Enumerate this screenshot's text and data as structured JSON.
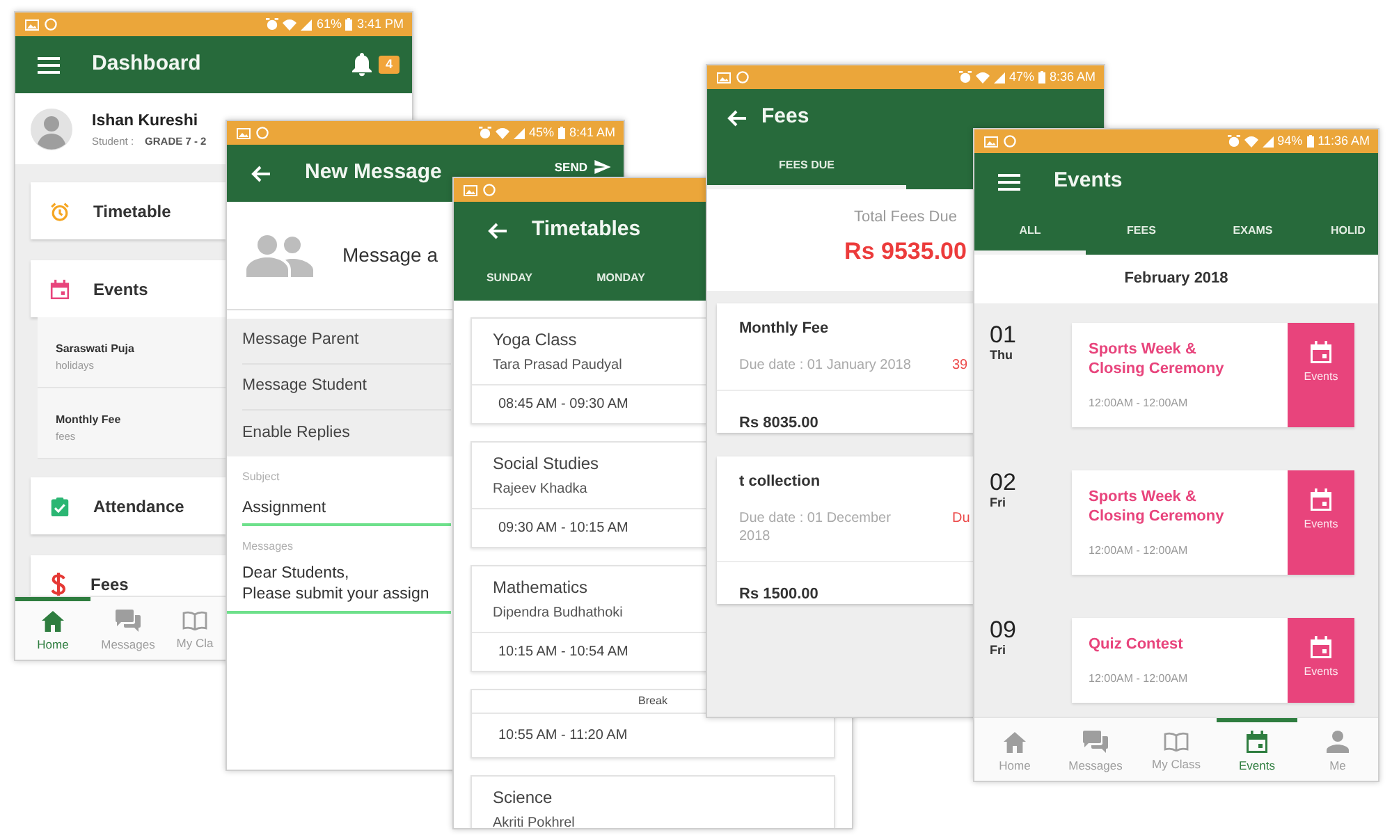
{
  "dashboard": {
    "status_bar": {
      "battery": "61%",
      "time": "3:41 PM"
    },
    "title": "Dashboard",
    "notification_count": "4",
    "profile": {
      "name": "Ishan Kureshi",
      "role": "Student :",
      "grade": "GRADE 7 - 2"
    },
    "menu": [
      {
        "label": "Timetable"
      },
      {
        "label": "Events",
        "children": [
          {
            "title": "Saraswati Puja",
            "category": "holidays"
          },
          {
            "title": "Monthly Fee",
            "category": "fees"
          }
        ]
      },
      {
        "label": "Attendance"
      },
      {
        "label": "Fees"
      }
    ],
    "bottom_nav": [
      {
        "label": "Home",
        "selected": true
      },
      {
        "label": "Messages",
        "selected": false
      },
      {
        "label": "My Cla",
        "selected": false
      }
    ]
  },
  "new_message": {
    "status_bar": {
      "battery": "45%",
      "time": "8:41 AM"
    },
    "title": "New Message",
    "action": "SEND",
    "recipients": "Message a",
    "options": [
      "Message Parent",
      "Message Student",
      "Enable Replies"
    ],
    "subject": {
      "label": "Subject",
      "value": "Assignment"
    },
    "message": {
      "label": "Messages",
      "value": "Dear Students,\nPlease submit your assign"
    }
  },
  "timetables": {
    "title": "Timetables",
    "tabs": [
      {
        "label": "SUNDAY",
        "selected": false
      },
      {
        "label": "MONDAY",
        "selected": false
      }
    ],
    "periods": [
      {
        "kind": "class",
        "subject": "Yoga Class",
        "teacher": "Tara Prasad Paudyal",
        "time": "08:45 AM - 09:30 AM"
      },
      {
        "kind": "class",
        "subject": "Social Studies",
        "teacher": "Rajeev Khadka",
        "time": "09:30 AM - 10:15 AM"
      },
      {
        "kind": "class",
        "subject": "Mathematics",
        "teacher": "Dipendra Budhathoki",
        "time": "10:15 AM - 10:54 AM"
      },
      {
        "kind": "break",
        "label": "Break",
        "time": "10:55 AM - 11:20 AM"
      },
      {
        "kind": "class",
        "subject": "Science",
        "teacher": "Akriti Pokhrel"
      }
    ]
  },
  "fees": {
    "status_bar": {
      "battery": "47%",
      "time": "8:36 AM"
    },
    "title": "Fees",
    "tabs": [
      {
        "label": "FEES DUE",
        "selected": true
      }
    ],
    "total_label": "Total Fees Due",
    "total": "Rs 9535.00",
    "items": [
      {
        "title": "Monthly Fee",
        "due_date": "Due date : 01 January 2018",
        "side_text": "39",
        "amount": "Rs 8035.00"
      },
      {
        "title": "t collection",
        "due_date": "Due date : 01 December 2018",
        "side_text": "Du",
        "amount": "Rs 1500.00"
      }
    ]
  },
  "events": {
    "status_bar": {
      "battery": "94%",
      "time": "11:36 AM"
    },
    "title": "Events",
    "tabs": [
      {
        "label": "ALL",
        "selected": true
      },
      {
        "label": "FEES",
        "selected": false
      },
      {
        "label": "EXAMS",
        "selected": false
      },
      {
        "label": "HOLID",
        "selected": false
      }
    ],
    "month": "February 2018",
    "days": [
      {
        "date": "01",
        "weekday": "Thu",
        "title": "Sports Week & Closing Ceremony",
        "time": "12:00AM - 12:00AM",
        "tag": "Events"
      },
      {
        "date": "02",
        "weekday": "Fri",
        "title": "Sports Week & Closing Ceremony",
        "time": "12:00AM - 12:00AM",
        "tag": "Events"
      },
      {
        "date": "09",
        "weekday": "Fri",
        "title": "Quiz Contest",
        "time": "12:00AM - 12:00AM",
        "tag": "Events"
      }
    ],
    "bottom_nav": [
      {
        "label": "Home",
        "selected": false
      },
      {
        "label": "Messages",
        "selected": false
      },
      {
        "label": "My Class",
        "selected": false
      },
      {
        "label": "Events",
        "selected": true
      },
      {
        "label": "Me",
        "selected": false
      }
    ]
  }
}
